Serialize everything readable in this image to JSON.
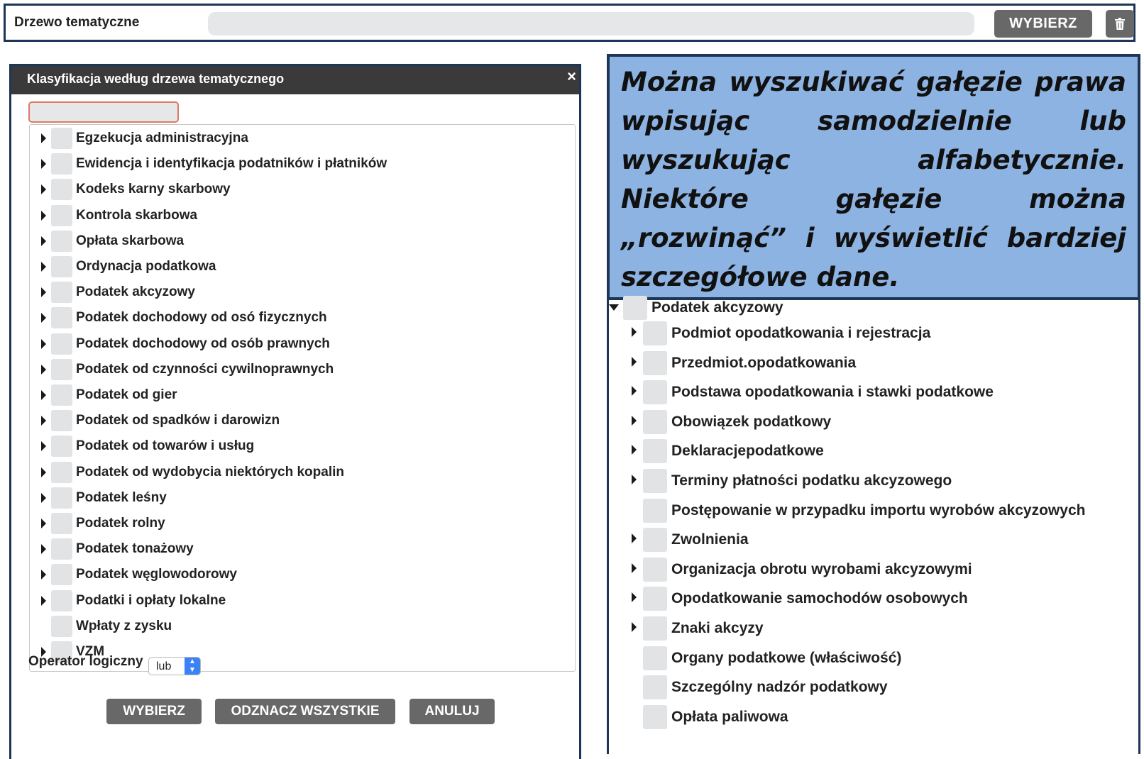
{
  "topbar": {
    "label": "Drzewo tematyczne",
    "choose_button": "WYBIERZ",
    "trash_icon": "trash-icon"
  },
  "dialog": {
    "title": "Klasyfikacja według drzewa tematycznego",
    "close_glyph": "×",
    "search_value": "",
    "items": [
      {
        "label": "Egzekucja administracyjna",
        "expandable": true
      },
      {
        "label": "Ewidencja i identyfikacja podatników i płatników",
        "expandable": true
      },
      {
        "label": "Kodeks karny skarbowy",
        "expandable": true
      },
      {
        "label": "Kontrola skarbowa",
        "expandable": true
      },
      {
        "label": "Opłata skarbowa",
        "expandable": true
      },
      {
        "label": "Ordynacja podatkowa",
        "expandable": true
      },
      {
        "label": "Podatek akcyzowy",
        "expandable": true
      },
      {
        "label": "Podatek dochodowy od osó fizycznych",
        "expandable": true
      },
      {
        "label": "Podatek dochodowy od osób prawnych",
        "expandable": true
      },
      {
        "label": "Podatek od czynności cywilnoprawnych",
        "expandable": true
      },
      {
        "label": "Podatek od gier",
        "expandable": true
      },
      {
        "label": "Podatek od spadków i darowizn",
        "expandable": true
      },
      {
        "label": "Podatek od towarów i usług",
        "expandable": true
      },
      {
        "label": "Podatek od wydobycia niektórych kopalin",
        "expandable": true
      },
      {
        "label": "Podatek leśny",
        "expandable": true
      },
      {
        "label": "Podatek rolny",
        "expandable": true
      },
      {
        "label": "Podatek tonażowy",
        "expandable": true
      },
      {
        "label": "Podatek węglowodorowy",
        "expandable": true
      },
      {
        "label": "Podatki i opłaty lokalne",
        "expandable": true
      },
      {
        "label": "Wpłaty z zysku",
        "expandable": false
      },
      {
        "label": "VZM",
        "expandable": true
      }
    ],
    "operator_label": "Operator logiczny",
    "operator_value": "lub",
    "buttons": {
      "choose": "WYBIERZ",
      "uncheck_all": "ODZNACZ WSZYSTKIE",
      "cancel": "ANULUJ"
    }
  },
  "callout": {
    "text": "Można wyszukiwać gałęzie prawa wpisując samodzielnie lub wyszukując alfabetycznie. Niektóre gałęzie można „rozwinąć” i wyświetlić bardziej szczegółowe dane."
  },
  "expanded_tree": {
    "root": {
      "label": "Podatek akcyzowy",
      "expanded": true
    },
    "children": [
      {
        "label": "Podmiot opodatkowania i rejestracja",
        "expandable": true
      },
      {
        "label": "Przedmiot.opodatkowania",
        "expandable": true
      },
      {
        "label": "Podstawa opodatkowania i stawki podatkowe",
        "expandable": true
      },
      {
        "label": "Obowiązek podatkowy",
        "expandable": true
      },
      {
        "label": "Deklaracjepodatkowe",
        "expandable": true
      },
      {
        "label": "Terminy płatności podatku akcyzowego",
        "expandable": true
      },
      {
        "label": "Postępowanie w przypadku importu wyrobów akcyzowych",
        "expandable": false
      },
      {
        "label": "Zwolnienia",
        "expandable": true
      },
      {
        "label": "Organizacja obrotu wyrobami akcyzowymi",
        "expandable": true
      },
      {
        "label": "Opodatkowanie samochodów osobowych",
        "expandable": true
      },
      {
        "label": "Znaki akcyzy",
        "expandable": true
      },
      {
        "label": "Organy podatkowe (właściwość)",
        "expandable": false
      },
      {
        "label": "Szczególny nadzór podatkowy",
        "expandable": false
      },
      {
        "label": "Opłata paliwowa",
        "expandable": false
      }
    ]
  }
}
